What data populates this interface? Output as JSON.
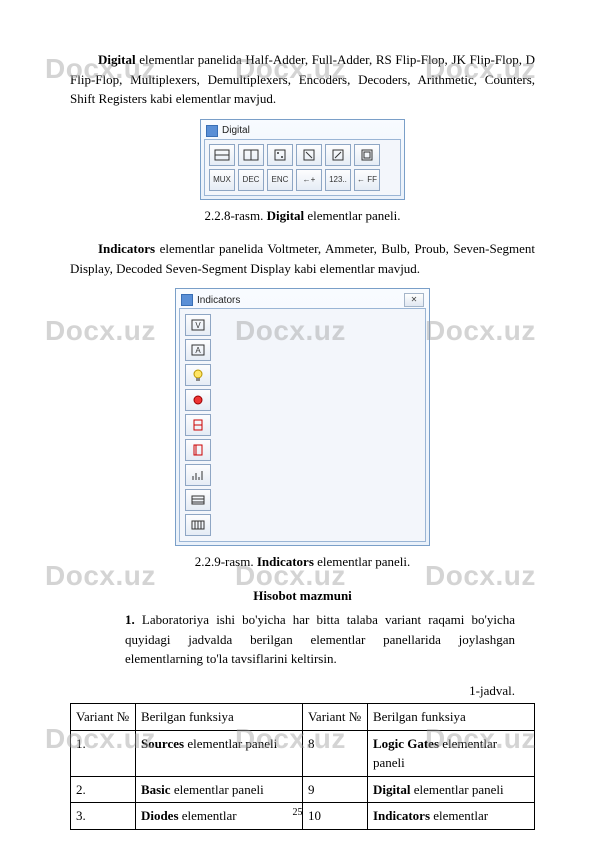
{
  "watermark": "Docx.uz",
  "p1": {
    "pre": "Digital",
    "text": " elementlar panelida Half-Adder, Full-Adder, RS Flip-Flop, JK Flip-Flop, D Flip-Flop, Multiplexers, Demultiplexers, Encoders, Decoders, Arithmetic, Counters, Shift Registers kabi elementlar mavjud."
  },
  "fig1": {
    "panel_title": "Digital",
    "caption_pre": "2.2.8-rasm. ",
    "caption_bold": "Digital",
    "caption_post": " elementlar paneli."
  },
  "p2": {
    "pre": "Indicators",
    "text": " elementlar panelida Voltmeter, Ammeter, Bulb, Proub, Seven-Segment Display, Decoded Seven-Segment Display kabi elementlar mavjud."
  },
  "fig2": {
    "panel_title": "Indicators",
    "close_x": "✕",
    "caption_pre": "2.2.9-rasm. ",
    "caption_bold": "Indicators",
    "caption_post": " elementlar paneli."
  },
  "heading": "Hisobot mazmuni",
  "task": {
    "num": "1.",
    "text": " Laboratoriya ishi bo'yicha har bitta talaba variant raqami bo'yicha quyidagi jadvalda berilgan elementlar panellarida joylashgan elementlarning to'la tavsiflarini keltirsin."
  },
  "table_label": "1-jadval.",
  "table": {
    "headers": {
      "c1": "Variant №",
      "c2": "Berilgan funksiya",
      "c3": "Variant №",
      "c4": "Berilgan funksiya"
    },
    "rows": [
      {
        "n1": "1.",
        "b1": "Sources",
        "t1": " elementlar paneli",
        "n2": "8",
        "b2": "Logic Gates",
        "t2": " elementlar paneli"
      },
      {
        "n1": "2.",
        "b1": "Basic",
        "t1": " elementlar paneli",
        "n2": "9",
        "b2": "Digital",
        "t2": " elementlar paneli"
      },
      {
        "n1": "3.",
        "b1": "Diodes",
        "t1": " elementlar",
        "n2": "10",
        "b2": "Indicators",
        "t2": " elementlar"
      }
    ]
  },
  "tool_labels": {
    "mux": "MUX",
    "dec": "DEC",
    "enc": "ENC",
    "ar": "←+",
    "cnt": "123..",
    "ff": "← FF"
  },
  "page_num": "25"
}
